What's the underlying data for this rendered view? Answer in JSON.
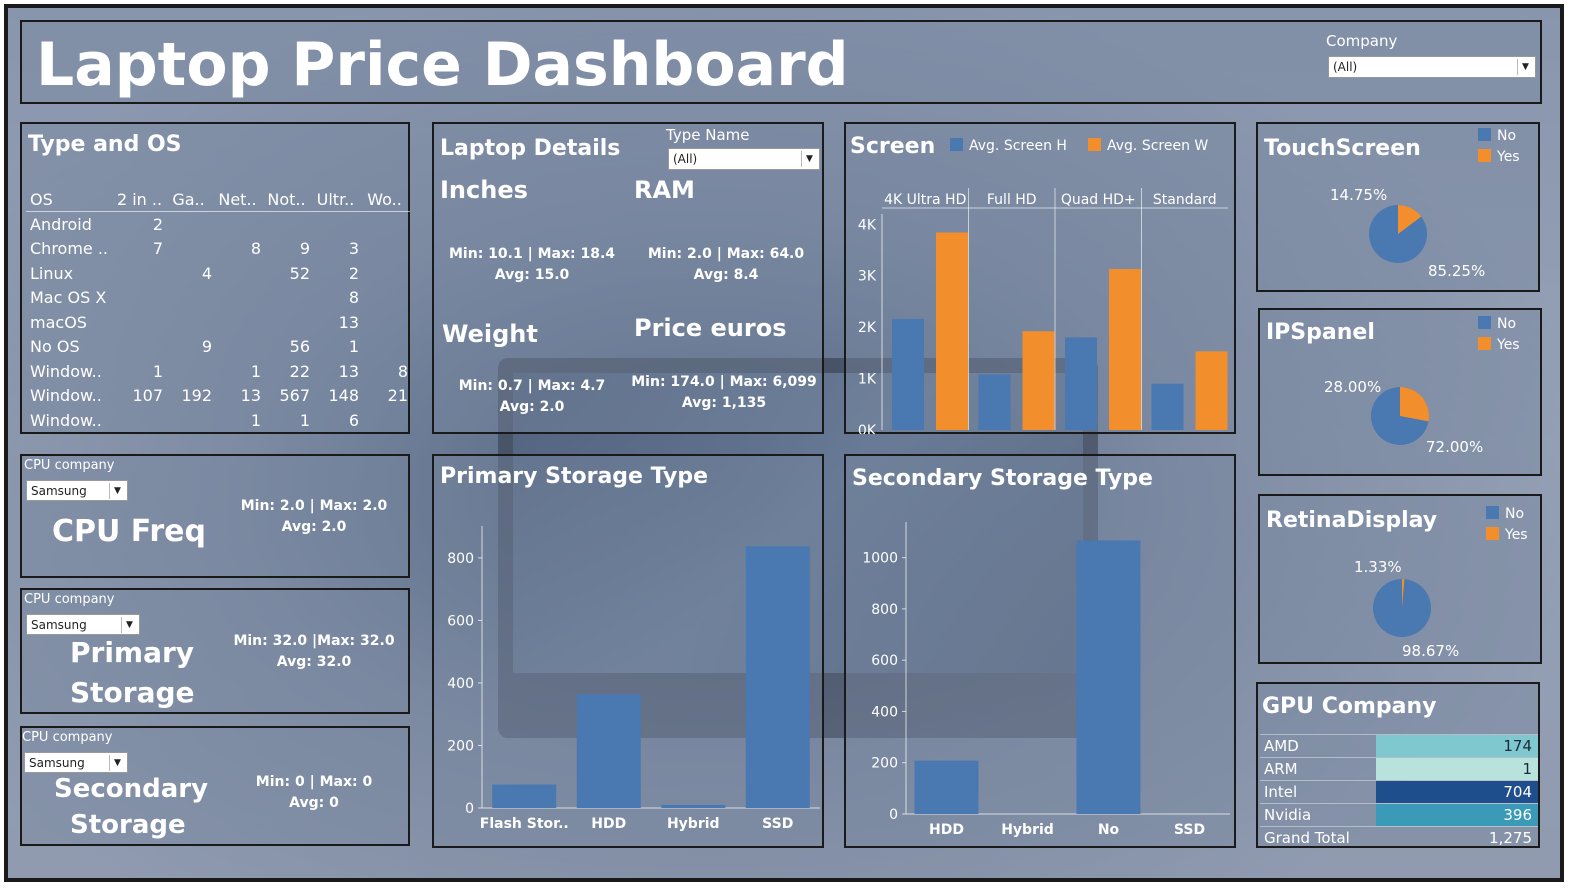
{
  "header": {
    "title": "Laptop Price Dashboard",
    "company_filter_label": "Company",
    "company_filter_value": "(All)"
  },
  "type_os": {
    "title": "Type and OS",
    "columns": [
      "OS",
      "2 in ..",
      "Ga..",
      "Net..",
      "Not..",
      "Ultr..",
      "Wo.."
    ],
    "rows": [
      [
        "Android",
        "2",
        "",
        "",
        "",
        "",
        ""
      ],
      [
        "Chrome ..",
        "7",
        "",
        "8",
        "9",
        "3",
        ""
      ],
      [
        "Linux",
        "",
        "4",
        "",
        "52",
        "2",
        ""
      ],
      [
        "Mac OS X",
        "",
        "",
        "",
        "",
        "8",
        ""
      ],
      [
        "macOS",
        "",
        "",
        "",
        "",
        "13",
        ""
      ],
      [
        "No OS",
        "",
        "9",
        "",
        "56",
        "1",
        ""
      ],
      [
        "Window..",
        "1",
        "",
        "1",
        "22",
        "13",
        "8"
      ],
      [
        "Window..",
        "107",
        "192",
        "13",
        "567",
        "148",
        "21"
      ],
      [
        "Window..",
        "",
        "",
        "1",
        "1",
        "6",
        ""
      ]
    ]
  },
  "laptop_details": {
    "title": "Laptop Details",
    "type_filter_label": "Type Name",
    "type_filter_value": "(All)",
    "inches_label": "Inches",
    "inches_stat1": "Min: 10.1 | Max: 18.4",
    "inches_stat2": "Avg: 15.0",
    "ram_label": "RAM",
    "ram_stat1": "Min: 2.0 | Max: 64.0",
    "ram_stat2": "Avg: 8.4",
    "weight_label": "Weight",
    "weight_stat1": "Min: 0.7 | Max: 4.7",
    "weight_stat2": "Avg: 2.0",
    "price_label": "Price euros",
    "price_stat1": "Min: 174.0 | Max:  6,099",
    "price_stat2": "Avg: 1,135"
  },
  "cpu_freq": {
    "filter_label": "CPU company",
    "filter_value": "Samsung",
    "label": "CPU Freq",
    "stat1": "Min: 2.0 | Max: 2.0",
    "stat2": "Avg: 2.0"
  },
  "primary_storage": {
    "filter_label": "CPU company",
    "filter_value": "Samsung",
    "label_line1": "Primary",
    "label_line2": "Storage",
    "stat1": "Min: 32.0 |Max:  32.0",
    "stat2": "Avg: 32.0"
  },
  "secondary_storage": {
    "filter_label": "CPU company",
    "filter_value": "Samsung",
    "label_line1": "Secondary",
    "label_line2": "Storage",
    "stat1": "Min: 0 | Max: 0",
    "stat2": "Avg: 0"
  },
  "screen": {
    "title": "Screen",
    "legend_h": "Avg. Screen H",
    "legend_w": "Avg. Screen W"
  },
  "touchscreen": {
    "title": "TouchScreen",
    "legend_no": "No",
    "legend_yes": "Yes",
    "pct_yes": "14.75%",
    "pct_no": "85.25%",
    "value_yes": 14.75
  },
  "ipspanel": {
    "title": "IPSpanel",
    "legend_no": "No",
    "legend_yes": "Yes",
    "pct_yes": "28.00%",
    "pct_no": "72.00%",
    "value_yes": 28.0
  },
  "retina": {
    "title": "RetinaDisplay",
    "legend_no": "No",
    "legend_yes": "Yes",
    "pct_yes": "1.33%",
    "pct_no": "98.67%",
    "value_yes": 1.33
  },
  "gpu": {
    "title": "GPU Company",
    "rows": [
      {
        "name": "AMD",
        "value": "174",
        "color": "#7fc8cf"
      },
      {
        "name": "ARM",
        "value": "1",
        "color": "#b7e3dc"
      },
      {
        "name": "Intel",
        "value": "704",
        "color": "#1f4e8c"
      },
      {
        "name": "Nvidia",
        "value": "396",
        "color": "#3a9ab8"
      }
    ],
    "total_label": "Grand Total",
    "total_value": "1,275"
  },
  "colors": {
    "blue": "#4a78b0",
    "orange": "#f28e2b"
  },
  "chart_data": [
    {
      "type": "bar",
      "title": "Screen",
      "categories": [
        "4K Ultra HD",
        "Full HD",
        "Quad HD+",
        "Standard"
      ],
      "series": [
        {
          "name": "Avg. Screen H",
          "values": [
            2160,
            1080,
            1800,
            900
          ]
        },
        {
          "name": "Avg. Screen W",
          "values": [
            3840,
            1920,
            3130,
            1530
          ]
        }
      ],
      "yticks": [
        "0K",
        "1K",
        "2K",
        "3K",
        "4K"
      ],
      "ylim": [
        0,
        4200
      ]
    },
    {
      "type": "bar",
      "title": "Primary Storage Type",
      "categories": [
        "Flash Stor..",
        "HDD",
        "Hybrid",
        "SSD"
      ],
      "values": [
        75,
        364,
        10,
        837
      ],
      "yticks": [
        "0",
        "200",
        "400",
        "600",
        "800"
      ],
      "ylim": [
        0,
        870
      ]
    },
    {
      "type": "bar",
      "title": "Secondary Storage Type",
      "categories": [
        "HDD",
        "Hybrid",
        "No",
        "SSD"
      ],
      "values": [
        208,
        0,
        1067,
        0
      ],
      "yticks": [
        "0",
        "200",
        "400",
        "600",
        "800",
        "1000"
      ],
      "ylim": [
        0,
        1100
      ]
    }
  ]
}
